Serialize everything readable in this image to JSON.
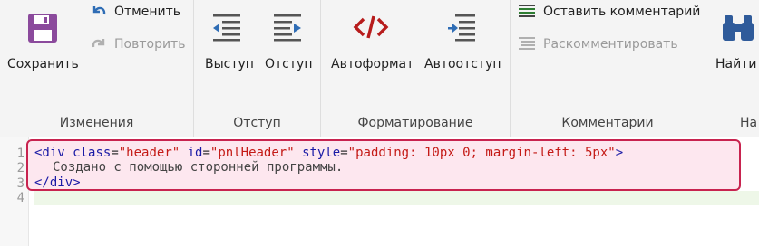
{
  "ribbon": {
    "save_label": "Сохранить",
    "undo_label": "Отменить",
    "redo_label": "Повторить",
    "outdent_label": "Выступ",
    "indent_label": "Отступ",
    "autoformat_label": "Автоформат",
    "autoindent_label": "Автоотступ",
    "comment_label": "Оставить комментарий",
    "uncomment_label": "Раскомментировать",
    "find_label": "Найти",
    "groups": {
      "changes": "Изменения",
      "indent": "Отступ",
      "formatting": "Форматирование",
      "comments": "Комментарии",
      "cut": "На"
    }
  },
  "editor": {
    "line_numbers": [
      "1",
      "2",
      "3",
      "4"
    ],
    "line1": {
      "open": "<div",
      "a1": "class",
      "v1": "\"header\"",
      "a2": "id",
      "v2": "\"pnlHeader\"",
      "a3": "style",
      "v3": "\"padding: 10px 0; margin-left: 5px\"",
      "close": ">"
    },
    "line2": "Создано с помощью сторонней программы.",
    "line3": "</div>"
  },
  "colors": {
    "highlight_border": "#c8234f",
    "highlight_bg": "#fde7ef",
    "tag": "#1a1aa6",
    "value": "#c41a16",
    "save_icon": "#8b4a9c",
    "blue_icon": "#2f6db5",
    "code_icon": "#b71c1c"
  },
  "icons": [
    "save-icon",
    "undo-icon",
    "redo-icon",
    "outdent-icon",
    "indent-icon",
    "code-icon",
    "autoindent-icon",
    "comment-icon",
    "uncomment-icon",
    "binoculars-icon"
  ]
}
